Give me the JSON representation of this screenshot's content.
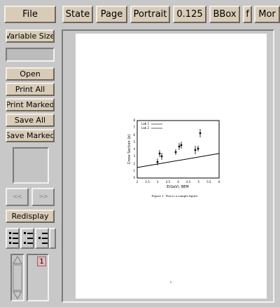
{
  "toolbar": {
    "file_label": "File",
    "state_label": "State",
    "page_label": "Page",
    "orientation_label": "Portrait",
    "magnification_label": "0.125",
    "bbox_label": "BBox",
    "truncated_label": "f",
    "more_label": "Mor"
  },
  "sidebar": {
    "variable_size_label": "Variable Size",
    "open_label": "Open",
    "print_all_label": "Print All",
    "print_marked_label": "Print Marked",
    "save_all_label": "Save All",
    "save_marked_label": "Save Marked",
    "prev_page_label": "<<",
    "next_page_label": ">>",
    "redisplay_label": "Redisplay"
  },
  "page_list": {
    "items": [
      "1"
    ]
  },
  "document": {
    "figure_caption": "Figure 1. This is a sample figure.",
    "page_number": "1",
    "plot": {
      "xlabel": "E(GeV), BEM",
      "ylabel": "Cross Section (b)",
      "xticks": [
        "2",
        "2.5",
        "3",
        "3.5",
        "4",
        "4.5",
        "5",
        "5.5",
        "6"
      ],
      "yticks": [
        "0",
        "1",
        "2",
        "3",
        "4",
        "5",
        "6",
        "7",
        "8"
      ],
      "legend": [
        "Lab 1",
        "Lab 2"
      ]
    }
  }
}
